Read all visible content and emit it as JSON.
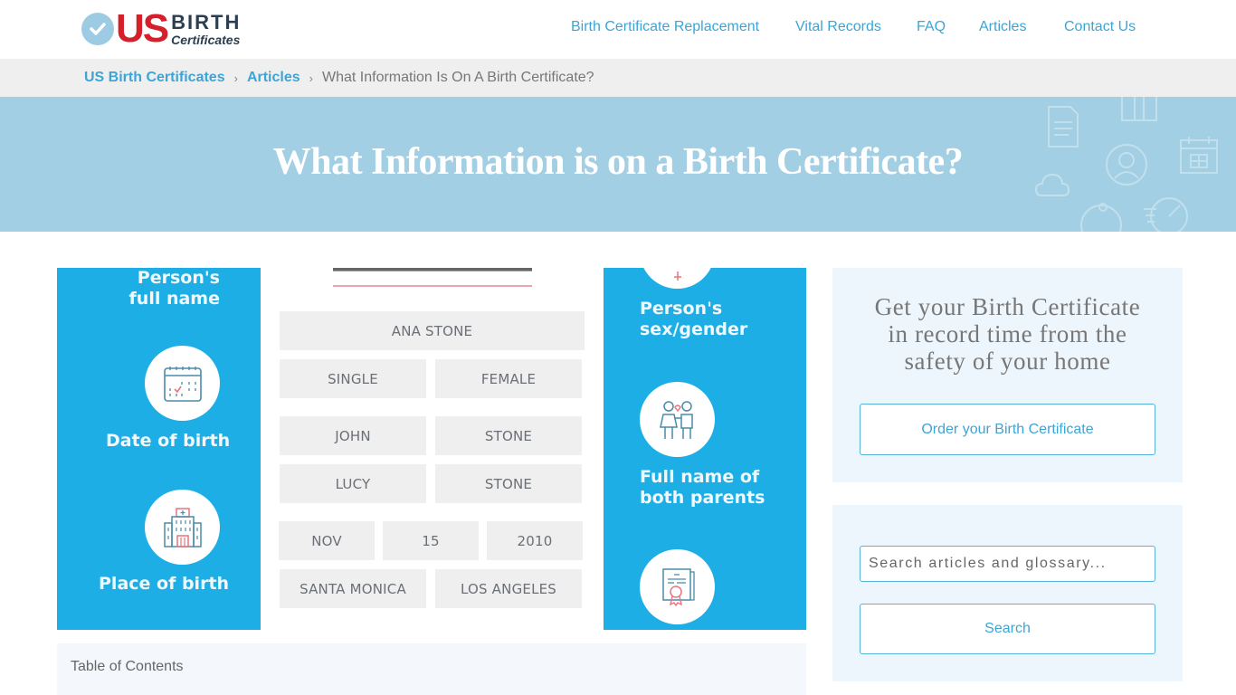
{
  "header": {
    "logo": {
      "us": "US",
      "birth": "BIRTH",
      "certificates": "Certificates"
    },
    "nav": [
      {
        "label": "Birth Certificate Replacement"
      },
      {
        "label": "Vital Records"
      },
      {
        "label": "FAQ"
      },
      {
        "label": "Articles"
      },
      {
        "label": "Contact Us"
      }
    ]
  },
  "breadcrumb": {
    "items": [
      {
        "label": "US Birth Certificates"
      },
      {
        "label": "Articles"
      }
    ],
    "separator": "›",
    "current": "What Information Is On A Birth Certificate?"
  },
  "hero": {
    "title": "What Information is on a Birth Certificate?"
  },
  "infographic": {
    "left_labels": [
      "Person's full name",
      "Date of birth",
      "Place of birth"
    ],
    "right_labels": [
      "Person's sex/gender",
      "Full name of both parents"
    ],
    "fields": {
      "full_name": "ANA STONE",
      "marital_status": "SINGLE",
      "sex": "FEMALE",
      "father_first": "JOHN",
      "father_last": "STONE",
      "mother_first": "LUCY",
      "mother_last": "STONE",
      "birth_month": "NOV",
      "birth_day": "15",
      "birth_year": "2010",
      "city": "SANTA MONICA",
      "county": "LOS ANGELES"
    },
    "icons": [
      "calendar-icon",
      "hospital-icon",
      "parents-icon",
      "certificate-icon"
    ],
    "colors": {
      "panel": "#1eaee6",
      "field_bg": "#efefef",
      "accent_red": "#e9747d"
    }
  },
  "toc": {
    "title": "Table of Contents"
  },
  "sidebar": {
    "cta": {
      "text": "Get your Birth Certificate in record time from the safety of your home",
      "button": "Order your Birth Certificate"
    },
    "search": {
      "placeholder": "Search articles and glossary...",
      "button": "Search"
    }
  },
  "colors": {
    "link": "#3ca5d6",
    "brand_red": "#d5202b",
    "hero_bg": "#a2cfe3",
    "card_bg": "#eef6fd"
  }
}
